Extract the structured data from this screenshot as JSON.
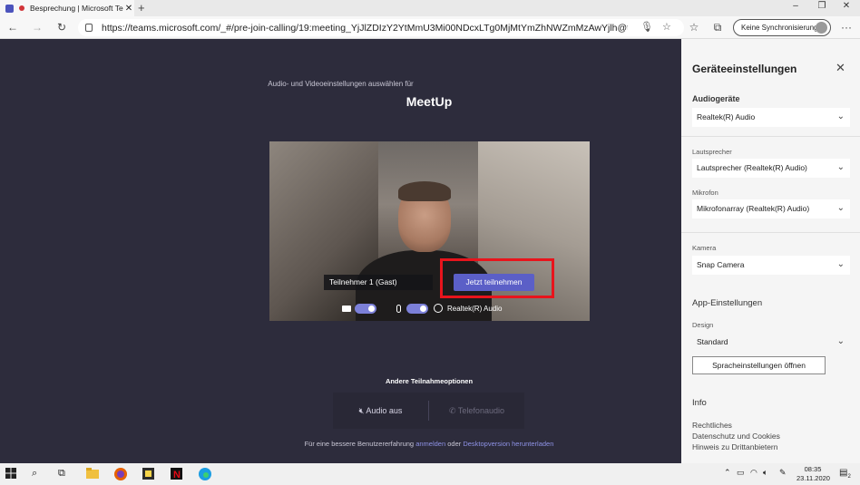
{
  "browser": {
    "tab_title": "Besprechung | Microsoft Te",
    "tab_close": "✕",
    "new_tab": "+",
    "url": "https://teams.microsoft.com/_#/pre-join-calling/19:meeting_YjJlZDIzY2YtMmU3Mi00NDcxLTg0MjMtYmZhNWZmMzAwYjlh@thread...",
    "sync_label": "Keine Synchronisierung",
    "more": "···",
    "window_controls": [
      "–",
      "❐",
      "✕"
    ]
  },
  "prejoin": {
    "subheading": "Audio- und Videoeinstellungen auswählen für",
    "meeting_title": "MeetUp",
    "participant_name": "Teilnehmer 1 (Gast)",
    "join_button": "Jetzt teilnehmen",
    "audio_device_label": "Realtek(R) Audio",
    "camera_on": true,
    "mic_on": true
  },
  "other_options": {
    "title": "Andere Teilnahmeoptionen",
    "audio_off": "Audio aus",
    "phone_audio": "Telefonaudio",
    "footnote_prefix": "Für eine bessere Benutzererfahrung",
    "footnote_link1": "anmelden",
    "footnote_mid": "oder",
    "footnote_link2": "Desktopversion herunterladen"
  },
  "panel": {
    "title": "Geräteeinstellungen",
    "close": "✕",
    "audio_devices_label": "Audiogeräte",
    "audio_device": "Realtek(R) Audio",
    "speaker_label": "Lautsprecher",
    "speaker_value": "Lautsprecher (Realtek(R) Audio)",
    "mic_label": "Mikrofon",
    "mic_value": "Mikrofonarray (Realtek(R) Audio)",
    "camera_label": "Kamera",
    "camera_value": "Snap Camera",
    "app_settings_label": "App-Einstellungen",
    "design_label": "Design",
    "design_value": "Standard",
    "lang_button": "Spracheinstellungen öffnen",
    "info_label": "Info",
    "links": [
      "Rechtliches",
      "Datenschutz und Cookies",
      "Hinweis zu Drittanbietern"
    ]
  },
  "taskbar": {
    "time": "08:35",
    "date": "23.11.2020",
    "notification_count": "2"
  },
  "colors": {
    "teams_bg": "#2d2c3c",
    "accent": "#5b5fc7",
    "highlight_frame": "#e8141c"
  }
}
